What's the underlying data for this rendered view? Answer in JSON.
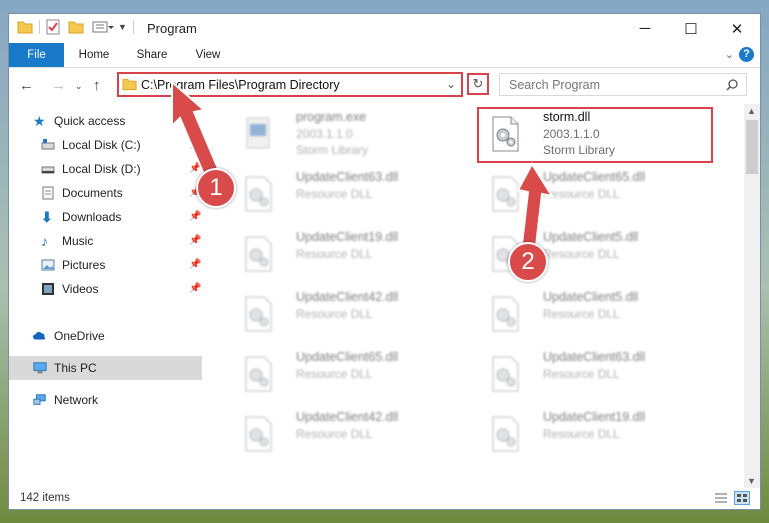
{
  "window": {
    "title": "Program",
    "controls": {
      "minimize": "─",
      "maximize": "☐",
      "close": "✕"
    }
  },
  "ribbon": {
    "tabs": [
      "File",
      "Home",
      "Share",
      "View"
    ]
  },
  "navigation": {
    "address": "C:\\Program Files\\Program Directory",
    "search_placeholder": "Search Program"
  },
  "sidebar": {
    "items": [
      {
        "label": "Quick access",
        "icon": "star-icon"
      },
      {
        "label": "Local Disk (C:)",
        "icon": "drive-icon",
        "pinned": true
      },
      {
        "label": "Local Disk (D:)",
        "icon": "drive-icon",
        "pinned": true
      },
      {
        "label": "Documents",
        "icon": "documents-icon",
        "pinned": true
      },
      {
        "label": "Downloads",
        "icon": "download-icon",
        "pinned": true
      },
      {
        "label": "Music",
        "icon": "music-icon",
        "pinned": true
      },
      {
        "label": "Pictures",
        "icon": "pictures-icon",
        "pinned": true
      },
      {
        "label": "Videos",
        "icon": "videos-icon",
        "pinned": true
      },
      {
        "label": "OneDrive",
        "icon": "cloud-icon"
      },
      {
        "label": "This PC",
        "icon": "computer-icon",
        "selected": true
      },
      {
        "label": "Network",
        "icon": "network-icon"
      }
    ]
  },
  "files": [
    {
      "name": "program.exe",
      "line1": "2003.1.1.0",
      "line2": "Storm Library",
      "blurred": true
    },
    {
      "name": "storm.dll",
      "line1": "2003.1.1.0",
      "line2": "Storm Library",
      "blurred": false
    },
    {
      "name": "UpdateClient63.dll",
      "line1": "Resource DLL",
      "blurred": true
    },
    {
      "name": "UpdateClient65.dll",
      "line1": "Resource DLL",
      "blurred": true
    },
    {
      "name": "UpdateClient19.dll",
      "line1": "Resource DLL",
      "blurred": true
    },
    {
      "name": "UpdateClient5.dll",
      "line1": "Resource DLL",
      "blurred": true
    },
    {
      "name": "UpdateClient42.dll",
      "line1": "Resource DLL",
      "blurred": true
    },
    {
      "name": "UpdateClient5.dll",
      "line1": "Resource DLL",
      "blurred": true
    },
    {
      "name": "UpdateClient65.dll",
      "line1": "Resource DLL",
      "blurred": true
    },
    {
      "name": "UpdateClient63.dll",
      "line1": "Resource DLL",
      "blurred": true
    },
    {
      "name": "UpdateClient42.dll",
      "line1": "Resource DLL",
      "blurred": true
    },
    {
      "name": "UpdateClient19.dll",
      "line1": "Resource DLL",
      "blurred": true
    }
  ],
  "status": {
    "item_count": "142 items"
  },
  "annotations": {
    "marker1": "1",
    "marker2": "2",
    "color": "#d9414b"
  }
}
